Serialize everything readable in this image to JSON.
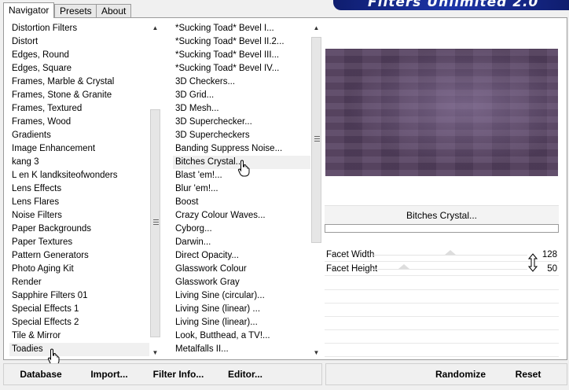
{
  "tabs": [
    "Navigator",
    "Presets",
    "About"
  ],
  "banner_title": "Filters Unlimited 2.0",
  "categories": [
    "Distortion Filters",
    "Distort",
    "Edges, Round",
    "Edges, Square",
    "Frames, Marble & Crystal",
    "Frames, Stone & Granite",
    "Frames, Textured",
    "Frames, Wood",
    "Gradients",
    "Image Enhancement",
    "kang 3",
    "L en K landksiteofwonders",
    "Lens Effects",
    "Lens Flares",
    "Noise Filters",
    "Paper Backgrounds",
    "Paper Textures",
    "Pattern Generators",
    "Photo Aging Kit",
    "Render",
    "Sapphire Filters 01",
    "Special Effects 1",
    "Special Effects 2",
    "Tile & Mirror",
    "Toadies"
  ],
  "filters": [
    "*Sucking Toad*  Bevel I...",
    "*Sucking Toad*  Bevel II.2...",
    "*Sucking Toad*  Bevel III...",
    "*Sucking Toad*  Bevel IV...",
    "3D Checkers...",
    "3D Grid...",
    "3D Mesh...",
    "3D Superchecker...",
    "3D Supercheckers",
    "Banding Suppress Noise...",
    "Bitches Crystal...",
    "Blast 'em!...",
    "Blur 'em!...",
    "Boost",
    "Crazy Colour Waves...",
    "Cyborg...",
    "Darwin...",
    "Direct Opacity...",
    "Glasswork Colour",
    "Glasswork Gray",
    "Living Sine (circular)...",
    "Living Sine (linear) ...",
    "Living Sine (linear)...",
    "Look, Butthead, a TV!...",
    "Metalfalls II..."
  ],
  "selected_category": "Toadies",
  "selected_filter": "Bitches Crystal...",
  "filter_name": "Bitches Crystal...",
  "progress": 1.0,
  "params": [
    {
      "label": "Facet Width",
      "value": "128",
      "fraction": 0.5
    },
    {
      "label": "Facet Height",
      "value": "50",
      "fraction": 0.2
    }
  ],
  "buttons": {
    "database": "Database",
    "import": "Import...",
    "filter_info": "Filter Info...",
    "editor": "Editor...",
    "randomize": "Randomize",
    "reset": "Reset"
  },
  "icons": {
    "hand_cursor": "hand-pointer-icon",
    "resize_cursor": "vertical-resize-icon"
  },
  "colors": {
    "banner": "#1d35a8",
    "preview": "#54405f"
  }
}
